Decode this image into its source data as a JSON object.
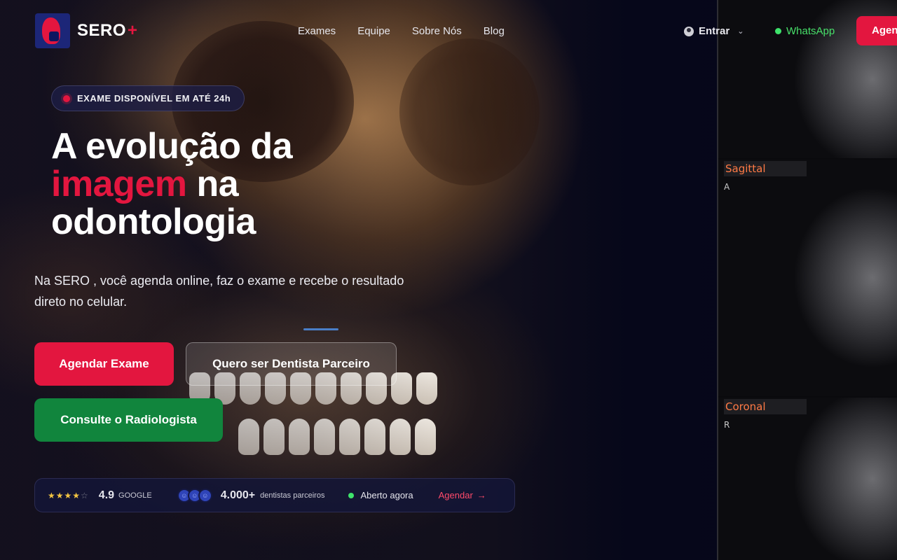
{
  "brand": {
    "name": "SERO",
    "plus": "+",
    "accent": "#e3163f",
    "navy": "#1c2678",
    "green": "#11853d"
  },
  "nav": {
    "items": [
      "Exames",
      "Equipe",
      "Sobre Nós",
      "Blog"
    ]
  },
  "header": {
    "login_label": "Entrar",
    "login_icon": "user-circle-icon",
    "whatsapp_label": "WhatsApp",
    "cta_label": "Agendar"
  },
  "badge": {
    "text": "EXAME DISPONÍVEL EM ATÉ 24h"
  },
  "hero": {
    "title_line1": "A evolução da",
    "title_accent": "imagem",
    "title_line2_rest": " na",
    "title_line3": "odontologia",
    "lead_prefix": "Na SERO",
    "lead_rest": " , você agenda online, faz o exame e recebe o resultado direto no celular."
  },
  "buttons": {
    "primary": "Agendar Exame",
    "partner": "Quero ser Dentista Parceiro",
    "radiologist": "Consulte o Radiologista"
  },
  "stats": {
    "stars": 4,
    "stars_display": "★★★★",
    "star_empty": "☆",
    "rating": "4.9",
    "rating_source": "GOOGLE",
    "partners_count": "4.000+",
    "partners_label": "dentistas parceiros",
    "open_label": "Aberto agora",
    "agendar_label": "Agendar",
    "arrow": "→"
  },
  "ct_views": {
    "sagittal": {
      "label": "Sagittal",
      "letter": "A"
    },
    "coronal": {
      "label": "Coronal",
      "letter": "R"
    }
  }
}
